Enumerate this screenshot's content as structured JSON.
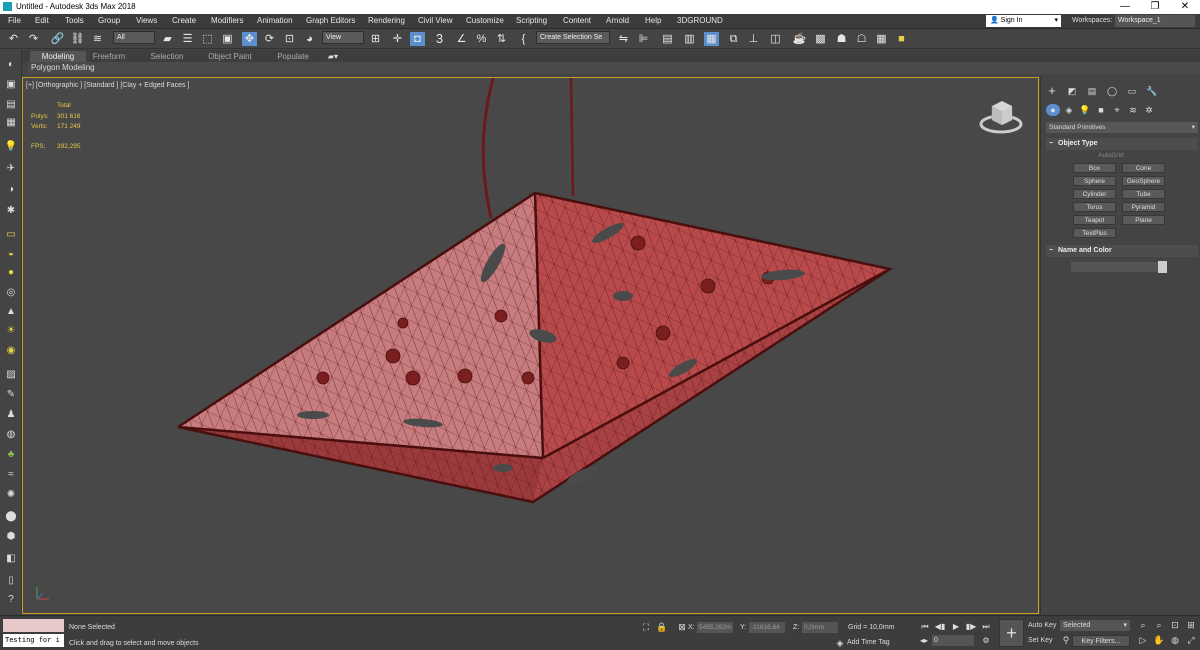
{
  "window": {
    "title": "Untitled - Autodesk 3ds Max 2018",
    "minimize": "—",
    "maximize": "❐",
    "close": "✕"
  },
  "menu": [
    "File",
    "Edit",
    "Tools",
    "Group",
    "Views",
    "Create",
    "Modifiers",
    "Animation",
    "Graph Editors",
    "Rendering",
    "Civil View",
    "Customize",
    "Scripting",
    "Content",
    "Arnold",
    "Help",
    "3DGROUND"
  ],
  "account": {
    "signin": "Sign In",
    "workspaces_label": "Workspaces:",
    "workspace": "Workspace_1"
  },
  "toolbar": {
    "filter": "All",
    "refcoord": "View",
    "named_selection": "Create Selection Se",
    "snap_value": "3",
    "angle_snap": "∠",
    "percent_snap": "%"
  },
  "ribbon": {
    "tabs": [
      "Modeling",
      "Freeform",
      "Selection",
      "Object Paint",
      "Populate"
    ],
    "panel_label": "Polygon Modeling"
  },
  "viewport": {
    "label": "[+] [Orthographic ] [Standard ] [Clay + Edged Faces ]",
    "stats": {
      "total_label": "Total",
      "polys_label": "Polys:",
      "polys": "301 616",
      "verts_label": "Verts:",
      "verts": "171 249",
      "fps_label": "FPS:",
      "fps": "392,295"
    }
  },
  "command_panel": {
    "category": "Standard Primitives",
    "object_type_title": "Object Type",
    "autogrid": "AutoGrid",
    "primitives": [
      "Box",
      "Cone",
      "Sphere",
      "GeoSphere",
      "Cylinder",
      "Tube",
      "Torus",
      "Pyramid",
      "Teapot",
      "Plane",
      "TextPlus"
    ],
    "name_color_title": "Name and Color"
  },
  "status": {
    "maxscript_input": "Testing for i",
    "selection": "None Selected",
    "prompt": "Click and drag to select and move objects",
    "x_label": "X:",
    "x_value": "5455,262m",
    "y_label": "Y:",
    "y_value": "-11616,64",
    "z_label": "Z:",
    "z_value": "0,0mm",
    "grid": "Grid = 10,0mm",
    "add_time_tag": "Add Time Tag",
    "frame": "0",
    "auto_key": "Auto Key",
    "set_key": "Set Key",
    "key_mode": "Selected",
    "key_filters": "Key Filters..."
  },
  "colors": {
    "accent": "#5b8fce",
    "viewport_border": "#c9a227",
    "mesh": "#b5484a",
    "mesh_dark": "#5a1414"
  }
}
